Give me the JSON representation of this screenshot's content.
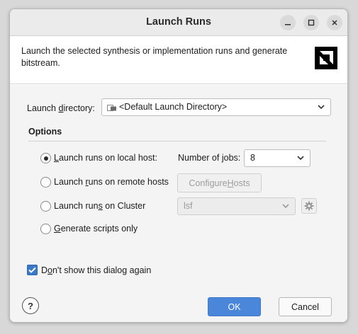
{
  "window": {
    "title": "Launch Runs",
    "controls": [
      "minimize-icon",
      "maximize-icon",
      "close-icon"
    ]
  },
  "header": {
    "description": "Launch the selected synthesis or implementation runs and generate bitstream.",
    "logo": "amd-logo"
  },
  "launch_directory": {
    "label_pre": "Launch ",
    "label_mnemonic": "d",
    "label_post": "irectory:",
    "value": "<Default Launch Directory>",
    "icon": "folder-icon"
  },
  "options": {
    "title": "Options",
    "local_host": {
      "selected": true,
      "label_mnemonic": "L",
      "label_post": "aunch runs on local host:",
      "jobs_label_pre": "Number of ",
      "jobs_label_mnemonic": "j",
      "jobs_label_post": "obs:",
      "jobs_value": "8"
    },
    "remote_hosts": {
      "selected": false,
      "label_pre": "Launch ",
      "label_mnemonic": "r",
      "label_post": "uns on remote hosts",
      "button_pre": "Configure ",
      "button_mnemonic": "H",
      "button_post": "osts"
    },
    "cluster": {
      "selected": false,
      "label_pre": "Launch run",
      "label_mnemonic": "s",
      "label_post": " on Cluster",
      "value": "lsf",
      "settings_icon": "gear-icon"
    },
    "scripts_only": {
      "selected": false,
      "label_mnemonic": "G",
      "label_post": "enerate scripts only"
    }
  },
  "dont_show": {
    "checked": true,
    "label_pre": "D",
    "label_mnemonic": "o",
    "label_post": "n't show this dialog again"
  },
  "footer": {
    "help_label": "?",
    "ok_label": "OK",
    "cancel_label": "Cancel"
  },
  "colors": {
    "accent": "#4a86d9",
    "checkbox": "#3c78c8",
    "title_bar": "#ebebeb",
    "body": "#f4f4f4"
  }
}
